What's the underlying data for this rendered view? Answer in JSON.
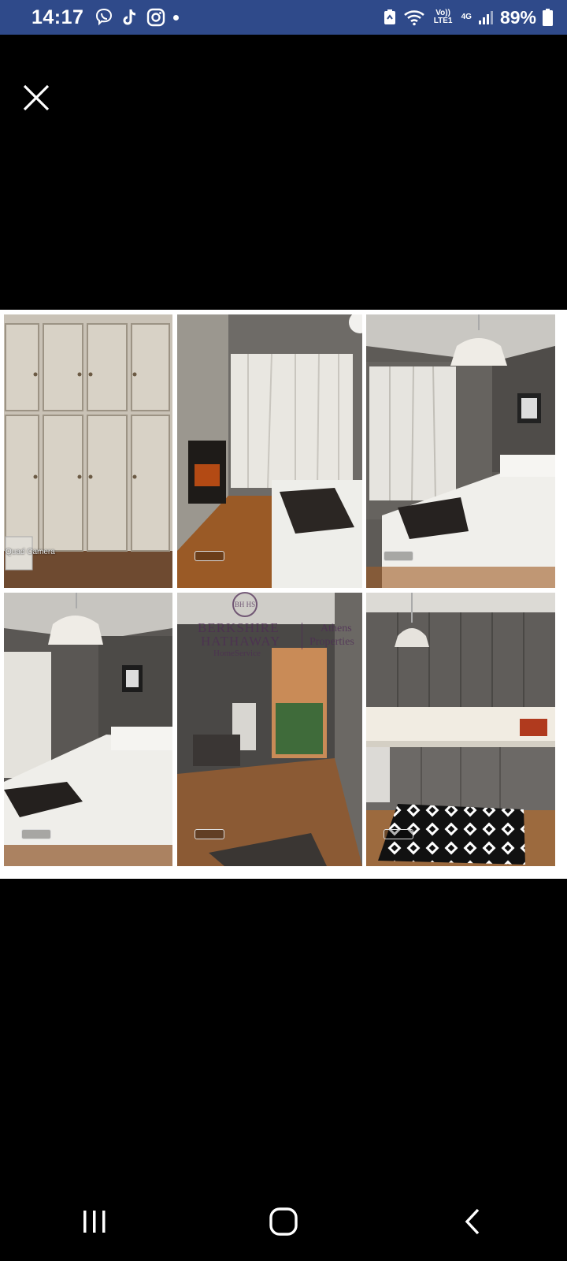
{
  "status_bar": {
    "time": "14:17",
    "left_icons": [
      "viber-icon",
      "tiktok-icon",
      "instagram-icon",
      "notification-dot-icon"
    ],
    "network_top": "Vo)) LTE1",
    "network_type": "4G",
    "battery_percent": "89%",
    "background": "#2f4a8a"
  },
  "viewer": {
    "close_icon": "close-icon"
  },
  "photo": {
    "tile_captions": [
      "Quad Camera",
      "",
      "",
      "",
      "",
      ""
    ],
    "watermark": {
      "logo": "BH HS",
      "line1": "BERKSHIRE",
      "line2": "HATHAWAY",
      "line3": "HomeService",
      "right1": "Athens",
      "right2": "Properties"
    }
  },
  "nav_bar": {
    "buttons": [
      "recent-apps-icon",
      "home-icon",
      "back-icon"
    ]
  }
}
